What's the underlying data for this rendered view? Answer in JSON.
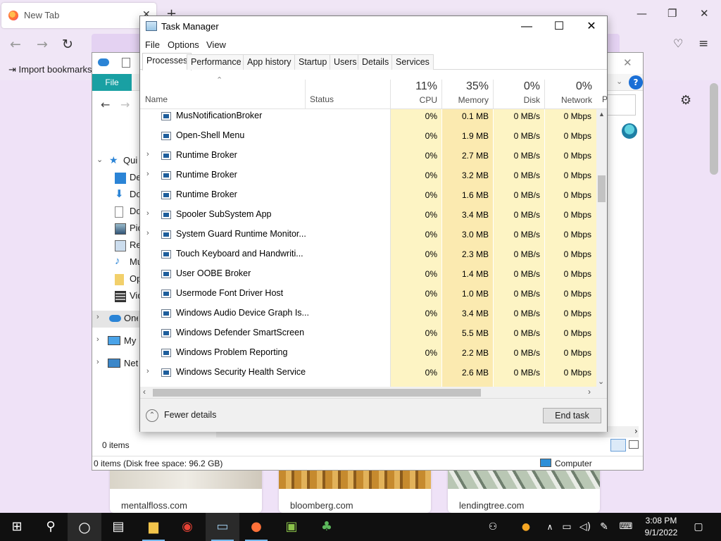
{
  "firefox": {
    "tab_title": "New Tab",
    "bookmark_label": "Import bookmarks...",
    "tiles": [
      "mentalfloss.com",
      "bloomberg.com",
      "lendingtree.com"
    ]
  },
  "explorer": {
    "file_tab": "File",
    "tree": [
      {
        "label": "Quick access",
        "chev": "⌄"
      },
      {
        "label": "Desktop",
        "chev": ""
      },
      {
        "label": "Downloads",
        "chev": ""
      },
      {
        "label": "Documents",
        "chev": ""
      },
      {
        "label": "Pictures",
        "chev": ""
      },
      {
        "label": "Recordings",
        "chev": ""
      },
      {
        "label": "Music",
        "chev": ""
      },
      {
        "label": "Open-Shell",
        "chev": ""
      },
      {
        "label": "Videos",
        "chev": ""
      },
      {
        "label": "OneDrive",
        "chev": "›"
      },
      {
        "label": "My Computer",
        "chev": "›"
      },
      {
        "label": "Network",
        "chev": "›"
      }
    ],
    "items_count": "0 items",
    "status_text": "0 items (Disk free space: 96.2 GB)",
    "status_location": "Computer"
  },
  "taskmanager": {
    "title": "Task Manager",
    "menu": [
      "File",
      "Options",
      "View"
    ],
    "tabs": [
      "Processes",
      "Performance",
      "App history",
      "Startup",
      "Users",
      "Details",
      "Services"
    ],
    "active_tab": "Processes",
    "headers": {
      "name": "Name",
      "status": "Status",
      "cpu_pct": "11%",
      "cpu_label": "CPU",
      "mem_pct": "35%",
      "mem_label": "Memory",
      "disk_pct": "0%",
      "disk_label": "Disk",
      "net_pct": "0%",
      "net_label": "Network",
      "power_label": "P"
    },
    "processes": [
      {
        "name": "MusNotificationBroker",
        "expand": false,
        "cpu": "0%",
        "mem": "0.1 MB",
        "disk": "0 MB/s",
        "net": "0 Mbps"
      },
      {
        "name": "Open-Shell Menu",
        "expand": false,
        "cpu": "0%",
        "mem": "1.9 MB",
        "disk": "0 MB/s",
        "net": "0 Mbps"
      },
      {
        "name": "Runtime Broker",
        "expand": true,
        "cpu": "0%",
        "mem": "2.7 MB",
        "disk": "0 MB/s",
        "net": "0 Mbps"
      },
      {
        "name": "Runtime Broker",
        "expand": true,
        "cpu": "0%",
        "mem": "3.2 MB",
        "disk": "0 MB/s",
        "net": "0 Mbps"
      },
      {
        "name": "Runtime Broker",
        "expand": false,
        "cpu": "0%",
        "mem": "1.6 MB",
        "disk": "0 MB/s",
        "net": "0 Mbps"
      },
      {
        "name": "Spooler SubSystem App",
        "expand": true,
        "cpu": "0%",
        "mem": "3.4 MB",
        "disk": "0 MB/s",
        "net": "0 Mbps"
      },
      {
        "name": "System Guard Runtime Monitor...",
        "expand": true,
        "cpu": "0%",
        "mem": "3.0 MB",
        "disk": "0 MB/s",
        "net": "0 Mbps"
      },
      {
        "name": "Touch Keyboard and Handwriti...",
        "expand": false,
        "cpu": "0%",
        "mem": "2.3 MB",
        "disk": "0 MB/s",
        "net": "0 Mbps"
      },
      {
        "name": "User OOBE Broker",
        "expand": false,
        "cpu": "0%",
        "mem": "1.4 MB",
        "disk": "0 MB/s",
        "net": "0 Mbps"
      },
      {
        "name": "Usermode Font Driver Host",
        "expand": false,
        "cpu": "0%",
        "mem": "1.0 MB",
        "disk": "0 MB/s",
        "net": "0 Mbps"
      },
      {
        "name": "Windows Audio Device Graph Is...",
        "expand": false,
        "cpu": "0%",
        "mem": "3.4 MB",
        "disk": "0 MB/s",
        "net": "0 Mbps"
      },
      {
        "name": "Windows Defender SmartScreen",
        "expand": false,
        "cpu": "0%",
        "mem": "5.5 MB",
        "disk": "0 MB/s",
        "net": "0 Mbps"
      },
      {
        "name": "Windows Problem Reporting",
        "expand": false,
        "cpu": "0%",
        "mem": "2.2 MB",
        "disk": "0 MB/s",
        "net": "0 Mbps"
      },
      {
        "name": "Windows Security Health Service",
        "expand": true,
        "cpu": "0%",
        "mem": "2.6 MB",
        "disk": "0 MB/s",
        "net": "0 Mbps"
      }
    ],
    "fewer_details": "Fewer details",
    "end_task": "End task"
  },
  "taskbar": {
    "time": "3:08 PM",
    "date": "9/1/2022"
  },
  "colors": {
    "heat_cpu": "#fdf4c4",
    "heat_mem": "#fbeab0",
    "heat_disk": "#fdf4c4",
    "heat_net": "#fdf4c4",
    "explorer_accent": "#19a0a3",
    "taskbar_bg": "#101010"
  }
}
